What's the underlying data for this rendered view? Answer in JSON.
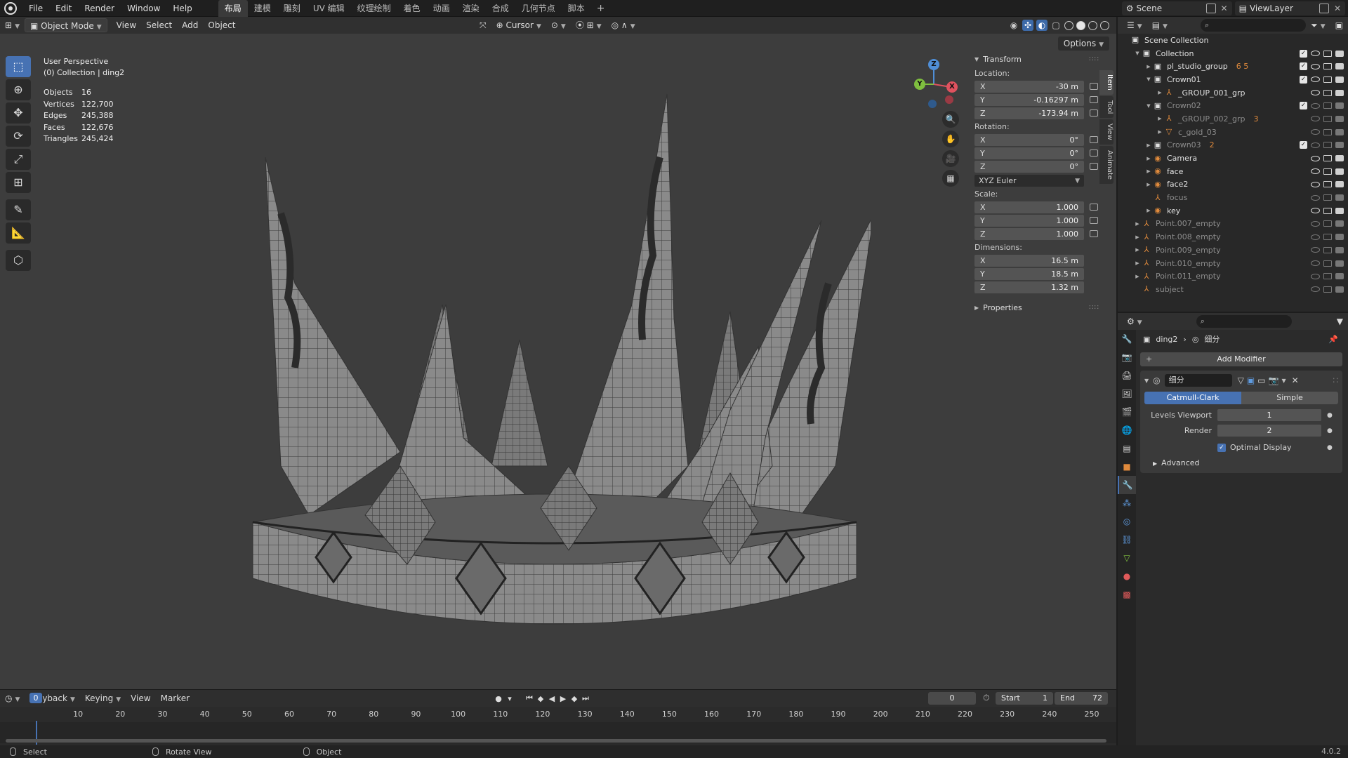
{
  "topbar": {
    "menus": [
      "File",
      "Edit",
      "Render",
      "Window",
      "Help"
    ],
    "workspaces": [
      "布局",
      "建模",
      "雕刻",
      "UV 编辑",
      "纹理绘制",
      "着色",
      "动画",
      "渲染",
      "合成",
      "几何节点",
      "脚本"
    ],
    "active_workspace": "布局",
    "scene": "Scene",
    "view_layer": "ViewLayer"
  },
  "viewport": {
    "mode": "Object Mode",
    "menus": [
      "View",
      "Select",
      "Add",
      "Object"
    ],
    "pivot": "Cursor",
    "options": "Options",
    "title": "User Perspective",
    "subtitle": "(0) Collection | ding2",
    "stats": [
      {
        "k": "Objects",
        "v": "16"
      },
      {
        "k": "Vertices",
        "v": "122,700"
      },
      {
        "k": "Edges",
        "v": "245,388"
      },
      {
        "k": "Faces",
        "v": "122,676"
      },
      {
        "k": "Triangles",
        "v": "245,424"
      }
    ],
    "gizmo": {
      "x": "X",
      "y": "Y",
      "z": "Z"
    }
  },
  "npanel": {
    "transform": "Transform",
    "location_label": "Location:",
    "location": [
      {
        "a": "X",
        "v": "-30 m"
      },
      {
        "a": "Y",
        "v": "-0.16297 m"
      },
      {
        "a": "Z",
        "v": "-173.94 m"
      }
    ],
    "rotation_label": "Rotation:",
    "rotation": [
      {
        "a": "X",
        "v": "0°"
      },
      {
        "a": "Y",
        "v": "0°"
      },
      {
        "a": "Z",
        "v": "0°"
      }
    ],
    "rotation_mode": "XYZ Euler",
    "scale_label": "Scale:",
    "scale": [
      {
        "a": "X",
        "v": "1.000"
      },
      {
        "a": "Y",
        "v": "1.000"
      },
      {
        "a": "Z",
        "v": "1.000"
      }
    ],
    "dimensions_label": "Dimensions:",
    "dimensions": [
      {
        "a": "X",
        "v": "16.5 m"
      },
      {
        "a": "Y",
        "v": "18.5 m"
      },
      {
        "a": "Z",
        "v": "1.32 m"
      }
    ],
    "properties": "Properties",
    "tabs": [
      "Item",
      "Tool",
      "View",
      "Animate"
    ]
  },
  "outliner": {
    "rows": [
      {
        "name": "Scene Collection",
        "depth": 0,
        "icon": "scene-collection-icon",
        "glyph": "▣",
        "tri": "",
        "dim": false,
        "extra": "",
        "chk": false,
        "eye": false
      },
      {
        "name": "Collection",
        "depth": 1,
        "icon": "collection-icon",
        "glyph": "▣",
        "tri": "▼",
        "dim": false,
        "extra": "",
        "chk": true,
        "eye": true
      },
      {
        "name": "pl_studio_group",
        "depth": 2,
        "icon": "collection-icon",
        "glyph": "▣",
        "tri": "▶",
        "dim": false,
        "extra": "6 5",
        "chk": true,
        "eye": true
      },
      {
        "name": "Crown01",
        "depth": 2,
        "icon": "collection-icon",
        "glyph": "▣",
        "tri": "▼",
        "dim": false,
        "extra": "",
        "chk": true,
        "eye": true
      },
      {
        "name": "_GROUP_001_grp",
        "depth": 3,
        "icon": "empty-icon",
        "glyph": "⅄",
        "tri": "▶",
        "dim": false,
        "extra": "",
        "chk": false,
        "eye": true
      },
      {
        "name": "Crown02",
        "depth": 2,
        "icon": "collection-icon",
        "glyph": "▣",
        "tri": "▼",
        "dim": true,
        "extra": "",
        "chk": true,
        "eye": false
      },
      {
        "name": "_GROUP_002_grp",
        "depth": 3,
        "icon": "empty-icon",
        "glyph": "⅄",
        "tri": "▶",
        "dim": true,
        "extra": "3",
        "chk": false,
        "eye": false
      },
      {
        "name": "c_gold_03",
        "depth": 3,
        "icon": "mesh-icon",
        "glyph": "▽",
        "tri": "▶",
        "dim": true,
        "extra": "",
        "chk": false,
        "eye": false
      },
      {
        "name": "Crown03",
        "depth": 2,
        "icon": "collection-icon",
        "glyph": "▣",
        "tri": "▶",
        "dim": true,
        "extra": "2",
        "chk": true,
        "eye": false
      },
      {
        "name": "Camera",
        "depth": 2,
        "icon": "camera-icon",
        "glyph": "◉",
        "tri": "▶",
        "dim": false,
        "extra": "",
        "chk": false,
        "eye": true
      },
      {
        "name": "face",
        "depth": 2,
        "icon": "light-icon",
        "glyph": "◉",
        "tri": "▶",
        "dim": false,
        "extra": "",
        "chk": false,
        "eye": true
      },
      {
        "name": "face2",
        "depth": 2,
        "icon": "light-icon",
        "glyph": "◉",
        "tri": "▶",
        "dim": false,
        "extra": "",
        "chk": false,
        "eye": true
      },
      {
        "name": "focus",
        "depth": 2,
        "icon": "empty-icon",
        "glyph": "⅄",
        "tri": "",
        "dim": true,
        "extra": "",
        "chk": false,
        "eye": false
      },
      {
        "name": "key",
        "depth": 2,
        "icon": "light-icon",
        "glyph": "◉",
        "tri": "▶",
        "dim": false,
        "extra": "",
        "chk": false,
        "eye": true
      },
      {
        "name": "Point.007_empty",
        "depth": 1,
        "icon": "empty-icon",
        "glyph": "⅄",
        "tri": "▶",
        "dim": true,
        "extra": "",
        "chk": false,
        "eye": false
      },
      {
        "name": "Point.008_empty",
        "depth": 1,
        "icon": "empty-icon",
        "glyph": "⅄",
        "tri": "▶",
        "dim": true,
        "extra": "",
        "chk": false,
        "eye": false
      },
      {
        "name": "Point.009_empty",
        "depth": 1,
        "icon": "empty-icon",
        "glyph": "⅄",
        "tri": "▶",
        "dim": true,
        "extra": "",
        "chk": false,
        "eye": false
      },
      {
        "name": "Point.010_empty",
        "depth": 1,
        "icon": "empty-icon",
        "glyph": "⅄",
        "tri": "▶",
        "dim": true,
        "extra": "",
        "chk": false,
        "eye": false
      },
      {
        "name": "Point.011_empty",
        "depth": 1,
        "icon": "empty-icon",
        "glyph": "⅄",
        "tri": "▶",
        "dim": true,
        "extra": "",
        "chk": false,
        "eye": false
      },
      {
        "name": "subject",
        "depth": 1,
        "icon": "empty-icon",
        "glyph": "⅄",
        "tri": "",
        "dim": true,
        "extra": "",
        "chk": false,
        "eye": false
      }
    ]
  },
  "properties": {
    "object": "ding2",
    "modifier_crumb": "细分",
    "add_modifier": "Add Modifier",
    "modifier_name": "细分",
    "mode_on": "Catmull-Clark",
    "mode_off": "Simple",
    "levels_viewport_label": "Levels Viewport",
    "levels_viewport": "1",
    "render_label": "Render",
    "render": "2",
    "optimal_display": "Optimal Display",
    "advanced": "Advanced"
  },
  "timeline": {
    "menus": [
      "Playback",
      "Keying",
      "View",
      "Marker"
    ],
    "current_frame": "0",
    "start_label": "Start",
    "start": "1",
    "end_label": "End",
    "end": "72",
    "ticks": [
      "10",
      "20",
      "30",
      "40",
      "50",
      "60",
      "70",
      "80",
      "90",
      "100",
      "110",
      "120",
      "130",
      "140",
      "150",
      "160",
      "170",
      "180",
      "190",
      "200",
      "210",
      "220",
      "230",
      "240",
      "250"
    ],
    "cursor": "0"
  },
  "status": {
    "select": "Select",
    "rotate": "Rotate View",
    "object": "Object",
    "version": "4.0.2"
  },
  "colors": {
    "accent": "#4772b3",
    "x_axis": "#e0525f",
    "y_axis": "#7fbf3f",
    "z_axis": "#4f8ed6"
  }
}
